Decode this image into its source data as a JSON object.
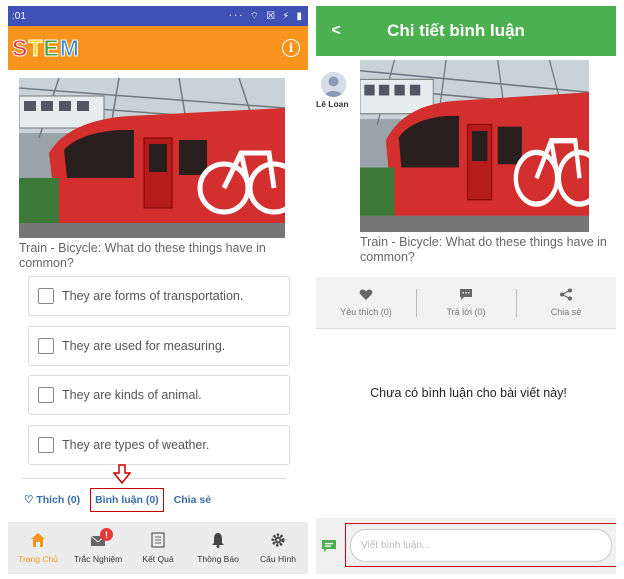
{
  "left": {
    "status": {
      "time": ":01",
      "icons": "··· ⌔ ☒ ⚡ ▮"
    },
    "logo": {
      "letters": [
        "S",
        "T",
        "E",
        "M"
      ],
      "colors": [
        "#e53935",
        "#f9d71c",
        "#43a047",
        "#1e88e5"
      ]
    },
    "question": "Train - Bicycle: What do these things have in common?",
    "options": [
      "They are forms of transportation.",
      "They are used for measuring.",
      "They are kinds of animal.",
      "They are types of weather."
    ],
    "actions": {
      "like": "♡ Thích (0)",
      "comment": "Bình luận (0)",
      "share": "Chia sẻ"
    },
    "tabs": [
      {
        "label": "Trang Chủ",
        "icon": "home-icon",
        "active": true
      },
      {
        "label": "Trắc Nghiệm",
        "icon": "mail-icon",
        "badge": "!"
      },
      {
        "label": "Kết Quả",
        "icon": "list-icon"
      },
      {
        "label": "Thông Báo",
        "icon": "bell-icon"
      },
      {
        "label": "Cấu Hình",
        "icon": "gear-icon"
      }
    ]
  },
  "right": {
    "title": "Chi tiết bình luận",
    "author": "Lê Loan",
    "question": "Train - Bicycle: What do these things have in common?",
    "actions": [
      {
        "label": "Yêu thích (0)",
        "icon": "heart-icon"
      },
      {
        "label": "Trả lời (0)",
        "icon": "comment-icon"
      },
      {
        "label": "Chia sẻ",
        "icon": "share-icon"
      }
    ],
    "empty_message": "Chưa có bình luận cho bài viết này!",
    "comment_placeholder": "Viết bình luận..."
  },
  "colors": {
    "status_bar": "#3f51b5",
    "left_header": "#f7941d",
    "right_header": "#4caf50",
    "link": "#3a6ea5",
    "highlight": "#cc0000",
    "train_red": "#d32f2f"
  }
}
